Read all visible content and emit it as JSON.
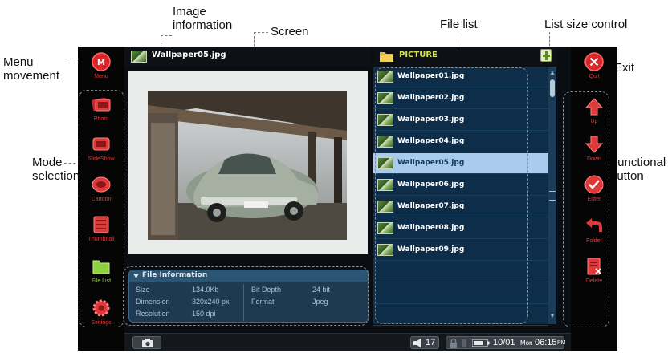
{
  "callouts": {
    "image_information": "Image\ninformation",
    "screen": "Screen",
    "file_list": "File list",
    "list_size_control": "List size control",
    "menu_movement": "Menu\nmovement",
    "exit": "Exit",
    "mode_selection": "Mode\nselection",
    "functional_button": "Functional\nbutton"
  },
  "left_rail": [
    {
      "label": "Menu",
      "icon": "menu-icon"
    },
    {
      "label": "Photo",
      "icon": "photo-icon"
    },
    {
      "label": "SlideShow",
      "icon": "slideshow-icon"
    },
    {
      "label": "Cartoon",
      "icon": "cartoon-icon"
    },
    {
      "label": "Thumbnail",
      "icon": "thumbnail-icon"
    },
    {
      "label": "File List",
      "icon": "folder-icon"
    },
    {
      "label": "Settings",
      "icon": "gear-icon"
    }
  ],
  "right_rail": [
    {
      "label": "Quit",
      "icon": "close-icon"
    },
    {
      "label": "Up",
      "icon": "arrow-up-icon"
    },
    {
      "label": "Down",
      "icon": "arrow-down-icon"
    },
    {
      "label": "Enter",
      "icon": "check-icon"
    },
    {
      "label": "Folder",
      "icon": "back-arrow-icon"
    },
    {
      "label": "Delete",
      "icon": "delete-icon"
    }
  ],
  "image_title": "Wallpaper05.jpg",
  "folder_title": "PICTURE",
  "files": [
    "Wallpaper01.jpg",
    "Wallpaper02.jpg",
    "Wallpaper03.jpg",
    "Wallpaper04.jpg",
    "Wallpaper05.jpg",
    "Wallpaper06.jpg",
    "Wallpaper07.jpg",
    "Wallpaper08.jpg",
    "Wallpaper09.jpg"
  ],
  "selected_index": 4,
  "file_info": {
    "header": "File Information",
    "size_label": "Size",
    "size_value": "134.0Kb",
    "dimension_label": "Dimension",
    "dimension_value": "320x240 px",
    "resolution_label": "Resolution",
    "resolution_value": "150 dpi",
    "bitdepth_label": "Bit Depth",
    "bitdepth_value": "24 bit",
    "format_label": "Format",
    "format_value": "Jpeg"
  },
  "status": {
    "volume": "17",
    "date": "10/01",
    "day": "Mon",
    "time": "06:15",
    "ampm": "PM"
  },
  "colors": {
    "accent_red": "#e0393a",
    "active_green": "#8fd040",
    "list_bg": "#0e2d48",
    "selected_row": "#a9ccec",
    "folder_title": "#d4e24a"
  }
}
